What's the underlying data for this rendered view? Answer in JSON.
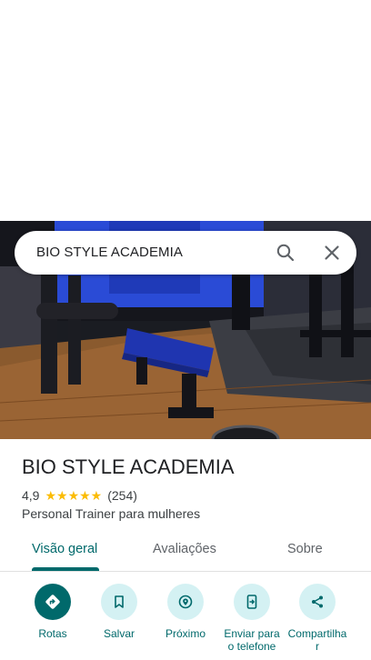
{
  "search": {
    "query": "BIO STYLE ACADEMIA",
    "search_icon": "search-icon",
    "close_icon": "close-icon"
  },
  "photo": {
    "description_icon": "gym-photo"
  },
  "place": {
    "name": "BIO STYLE ACADEMIA",
    "rating": "4,9",
    "stars": "★★★★★",
    "review_count": "(254)",
    "category": "Personal Trainer para mulheres"
  },
  "tabs": [
    {
      "label": "Visão geral",
      "active": true
    },
    {
      "label": "Avaliações",
      "active": false
    },
    {
      "label": "Sobre",
      "active": false
    }
  ],
  "actions": [
    {
      "label": "Rotas",
      "icon": "directions-icon"
    },
    {
      "label": "Salvar",
      "icon": "bookmark-icon"
    },
    {
      "label": "Próximo",
      "icon": "nearby-icon"
    },
    {
      "label": "Enviar para o telefone",
      "icon": "send-to-phone-icon"
    },
    {
      "label": "Compartilhar",
      "icon": "share-icon"
    }
  ],
  "colors": {
    "accent": "#00696b",
    "accent_light": "#d4f1f3",
    "star": "#fbbc04",
    "text": "#202124"
  }
}
